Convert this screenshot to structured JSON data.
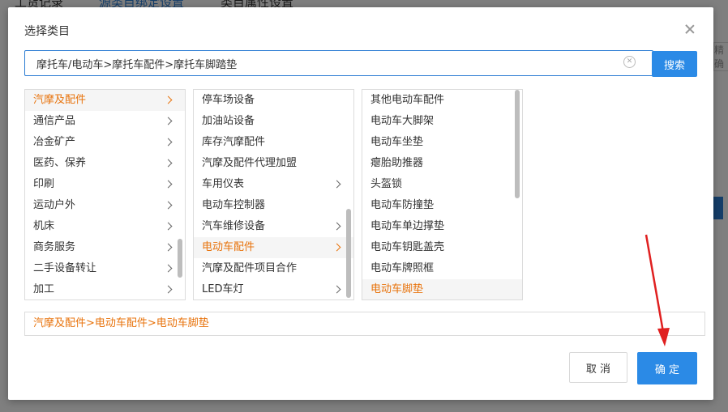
{
  "background": {
    "tabs": [
      "工货记录",
      "源类目绑定设置",
      "类目属性设置"
    ],
    "right_box_text": "精确"
  },
  "dialog": {
    "title": "选择类目",
    "search_value": "摩托车/电动车>摩托车配件>摩托车脚踏垫",
    "search_button": "搜索",
    "col1": [
      {
        "label": "汽摩及配件",
        "active": true,
        "chevron": true
      },
      {
        "label": "通信产品",
        "active": false,
        "chevron": true
      },
      {
        "label": "冶金矿产",
        "active": false,
        "chevron": true
      },
      {
        "label": "医药、保养",
        "active": false,
        "chevron": true
      },
      {
        "label": "印刷",
        "active": false,
        "chevron": true
      },
      {
        "label": "运动户外",
        "active": false,
        "chevron": true
      },
      {
        "label": "机床",
        "active": false,
        "chevron": true
      },
      {
        "label": "商务服务",
        "active": false,
        "chevron": true
      },
      {
        "label": "二手设备转让",
        "active": false,
        "chevron": true
      },
      {
        "label": "加工",
        "active": false,
        "chevron": true
      }
    ],
    "col2": [
      {
        "label": "停车场设备",
        "active": false,
        "chevron": false
      },
      {
        "label": "加油站设备",
        "active": false,
        "chevron": false
      },
      {
        "label": "库存汽摩配件",
        "active": false,
        "chevron": false
      },
      {
        "label": "汽摩及配件代理加盟",
        "active": false,
        "chevron": false
      },
      {
        "label": "车用仪表",
        "active": false,
        "chevron": true
      },
      {
        "label": "电动车控制器",
        "active": false,
        "chevron": false
      },
      {
        "label": "汽车维修设备",
        "active": false,
        "chevron": true
      },
      {
        "label": "电动车配件",
        "active": true,
        "chevron": true
      },
      {
        "label": "汽摩及配件项目合作",
        "active": false,
        "chevron": false
      },
      {
        "label": "LED车灯",
        "active": false,
        "chevron": true
      }
    ],
    "col3": [
      {
        "label": "其他电动车配件",
        "active": false
      },
      {
        "label": "电动车大脚架",
        "active": false
      },
      {
        "label": "电动车坐垫",
        "active": false
      },
      {
        "label": "瘪胎助推器",
        "active": false
      },
      {
        "label": "头盔锁",
        "active": false
      },
      {
        "label": "电动车防撞垫",
        "active": false
      },
      {
        "label": "电动车单边撑垫",
        "active": false
      },
      {
        "label": "电动车钥匙盖壳",
        "active": false
      },
      {
        "label": "电动车牌照框",
        "active": false
      },
      {
        "label": "电动车脚垫",
        "active": true
      }
    ],
    "selected_path": "汽摩及配件>电动车配件>电动车脚垫",
    "cancel_button": "取 消",
    "ok_button": "确 定"
  },
  "colors": {
    "accent": "#2b8ae6",
    "active_text": "#e8730c",
    "annotation_arrow": "#e02020"
  }
}
